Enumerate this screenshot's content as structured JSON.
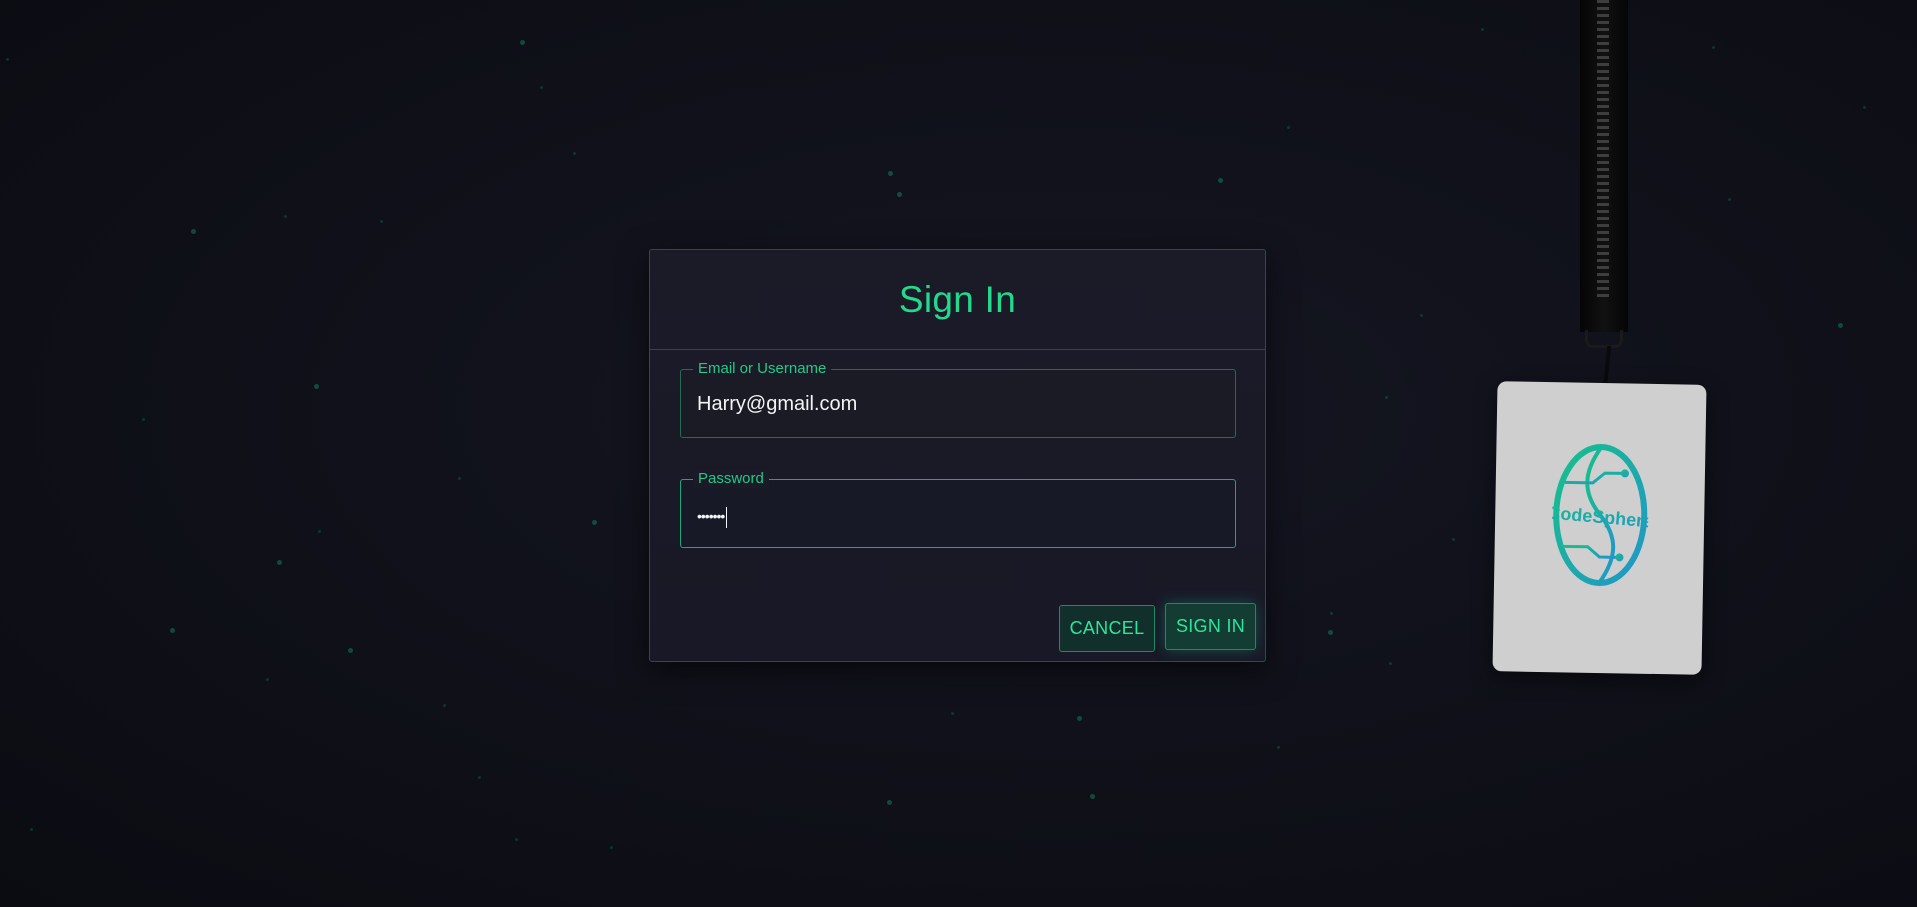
{
  "dialog": {
    "title": "Sign In",
    "email": {
      "legend": "Email or Username",
      "value": "Harry@gmail.com"
    },
    "password": {
      "legend": "Password",
      "masked_value": "•••••••"
    },
    "buttons": {
      "cancel_label": "CANCEL",
      "signin_label": "SIGN IN"
    }
  },
  "badge": {
    "logo_text": "CodeSphere"
  },
  "colors": {
    "accent": "#22d98e",
    "background": "#0f1018",
    "dialog_bg": "#1a1a27",
    "badge_bg": "#cfcfcf"
  }
}
